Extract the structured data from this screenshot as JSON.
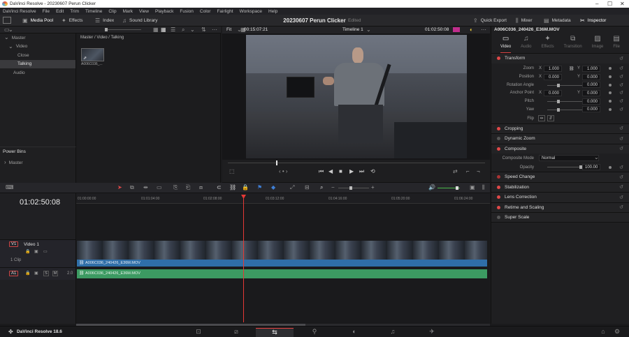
{
  "window": {
    "title": "DaVinci Resolve - 20230607 Perun Clicker"
  },
  "menu": [
    "DaVinci Resolve",
    "File",
    "Edit",
    "Trim",
    "Timeline",
    "Clip",
    "Mark",
    "View",
    "Playback",
    "Fusion",
    "Color",
    "Fairlight",
    "Workspace",
    "Help"
  ],
  "toolbar": {
    "media_pool": "Media Pool",
    "effects": "Effects",
    "index": "Index",
    "sound_library": "Sound Library",
    "project_title": "20230607 Perun Clicker",
    "edited": "Edited",
    "quick_export": "Quick Export",
    "mixer": "Mixer",
    "metadata": "Metadata",
    "inspector": "Inspector"
  },
  "bins": {
    "items": [
      "Master",
      "Video",
      "Close",
      "Talking",
      "Audio"
    ],
    "selected": "Talking",
    "power_bins_title": "Power Bins",
    "power_bins_item": "Master"
  },
  "pool": {
    "path": "Master / Video / Talking",
    "clip_name": "A006C036_..."
  },
  "viewer": {
    "fit": "Fit",
    "source_tc": "00:15:07:21",
    "timeline_name": "Timeline 1",
    "record_tc": "01:02:50:08"
  },
  "inspector": {
    "clip_title": "A006C036_240426_E36M.MOV",
    "tabs": [
      "Video",
      "Audio",
      "Effects",
      "Transition",
      "Image",
      "File"
    ],
    "active_tab": "Video",
    "transform": {
      "title": "Transform",
      "zoom_label": "Zoom",
      "zoom_x": "1.000",
      "zoom_y": "1.000",
      "position_label": "Position",
      "position_x": "0.000",
      "position_y": "0.000",
      "rotation_label": "Rotation Angle",
      "rotation": "0.000",
      "anchor_label": "Anchor Point",
      "anchor_x": "0.000",
      "anchor_y": "0.000",
      "pitch_label": "Pitch",
      "pitch": "0.000",
      "yaw_label": "Yaw",
      "yaw": "0.000",
      "flip_label": "Flip",
      "x": "X",
      "y": "Y"
    },
    "cropping": "Cropping",
    "dynamic_zoom": "Dynamic Zoom",
    "composite": {
      "title": "Composite",
      "mode_label": "Composite Mode",
      "mode": "Normal",
      "opacity_label": "Opacity",
      "opacity": "100.00"
    },
    "speed_change": "Speed Change",
    "stabilization": "Stabilization",
    "lens_correction": "Lens Correction",
    "retime_scaling": "Retime and Scaling",
    "super_scale": "Super Scale"
  },
  "timeline": {
    "timecode": "01:02:50:08",
    "ruler": [
      "01:00:00:00",
      "01:01:04:00",
      "01:02:08:00",
      "01:03:12:00",
      "01:04:16:00",
      "01:05:20:00",
      "01:06:24:00"
    ],
    "v1": {
      "tag": "V1",
      "name": "Video 1",
      "clips": "1 Clip"
    },
    "a1": {
      "tag": "A1",
      "level": "2.0"
    },
    "video_clip": "A006C036_240426_E36M.MOV",
    "audio_clip": "A006C036_240426_E36M.MOV"
  },
  "footer": {
    "app": "DaVinci Resolve 18.6"
  }
}
